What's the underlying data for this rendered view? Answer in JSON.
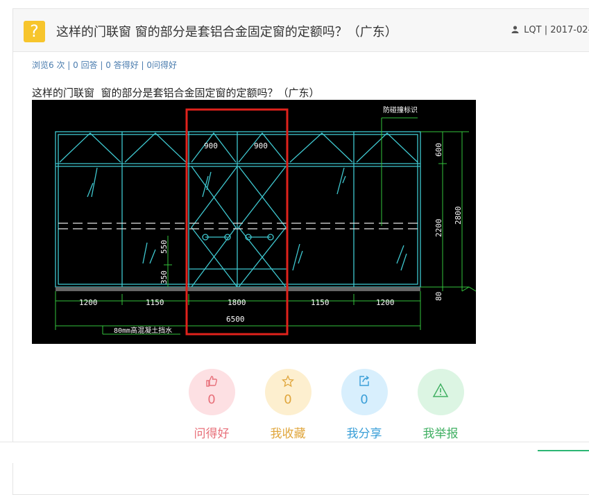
{
  "question": {
    "icon": "?",
    "title": "这样的门联窗 窗的部分是套铝合金固定窗的定额吗？（广东）",
    "author": "LQT",
    "date": "2017-02-",
    "stats": "浏览6 次 | 0 回答 | 0 答得好 | 0问得好",
    "body": "这样的门联窗  窗的部分是套铝合金固定窗的定额吗？（广东）"
  },
  "drawing": {
    "label_fire": "防碰撞标识",
    "dim_top_left": "900",
    "dim_top_right": "900",
    "dim_right_600": "600",
    "dim_right_2200": "2200",
    "dim_right_2800": "2800",
    "dim_right_80": "80",
    "dim_550": "550",
    "dim_350": "350",
    "dims_bottom": [
      "1200",
      "1150",
      "1800",
      "1150",
      "1200"
    ],
    "dim_total": "6500",
    "note": "80mm高混凝土挡水"
  },
  "actions": [
    {
      "label": "问得好",
      "count": "0",
      "icon": "thumbs-up-icon",
      "bg": "#fde0e3",
      "fg": "#e8707a"
    },
    {
      "label": "我收藏",
      "count": "0",
      "icon": "star-icon",
      "bg": "#fdefcf",
      "fg": "#e0a63c"
    },
    {
      "label": "我分享",
      "count": "0",
      "icon": "share-icon",
      "bg": "#d8effd",
      "fg": "#3a9fd8"
    },
    {
      "label": "我举报",
      "count": "",
      "icon": "warning-icon",
      "bg": "#dcf5e3",
      "fg": "#41b063"
    }
  ],
  "colors": {
    "accent_yellow": "#f7c52c",
    "link_blue": "#4a7cae"
  }
}
